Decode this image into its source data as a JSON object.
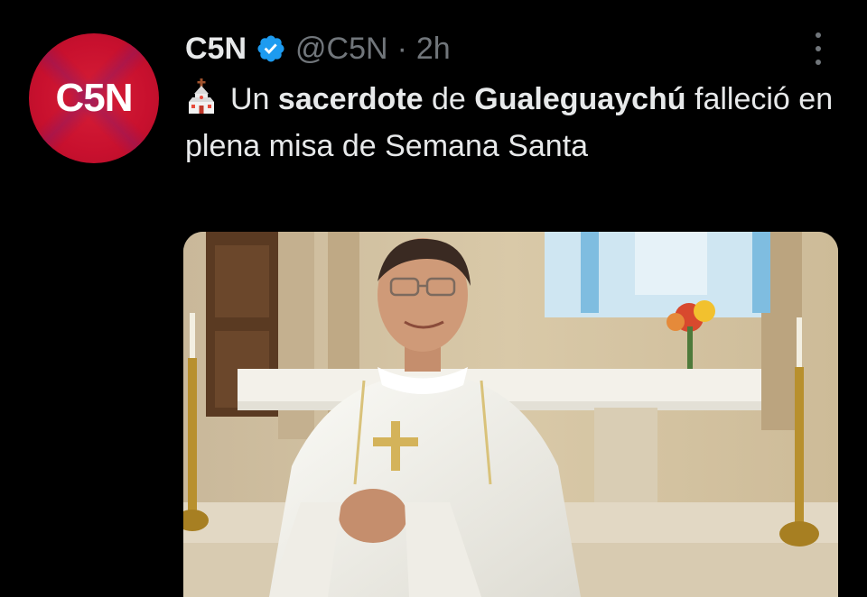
{
  "author": {
    "display_name": "C5N",
    "avatar_text": "C5N",
    "handle": "@C5N",
    "separator": "·",
    "time": "2h",
    "verified_icon": "verified-badge-icon"
  },
  "tweet": {
    "emoji_icon": "church-icon",
    "text_parts": {
      "p1": "Un ",
      "p2": "sacerdote",
      "p3": " de ",
      "p4": "Gualeguaychú",
      "p5": " falleció en plena misa de Semana Santa"
    },
    "media_description_icon": "photo"
  },
  "colors": {
    "background": "#000000",
    "text": "#e7e9ea",
    "secondary": "#71767b",
    "verified": "#1d9bf0",
    "avatar": "#c8102e"
  }
}
